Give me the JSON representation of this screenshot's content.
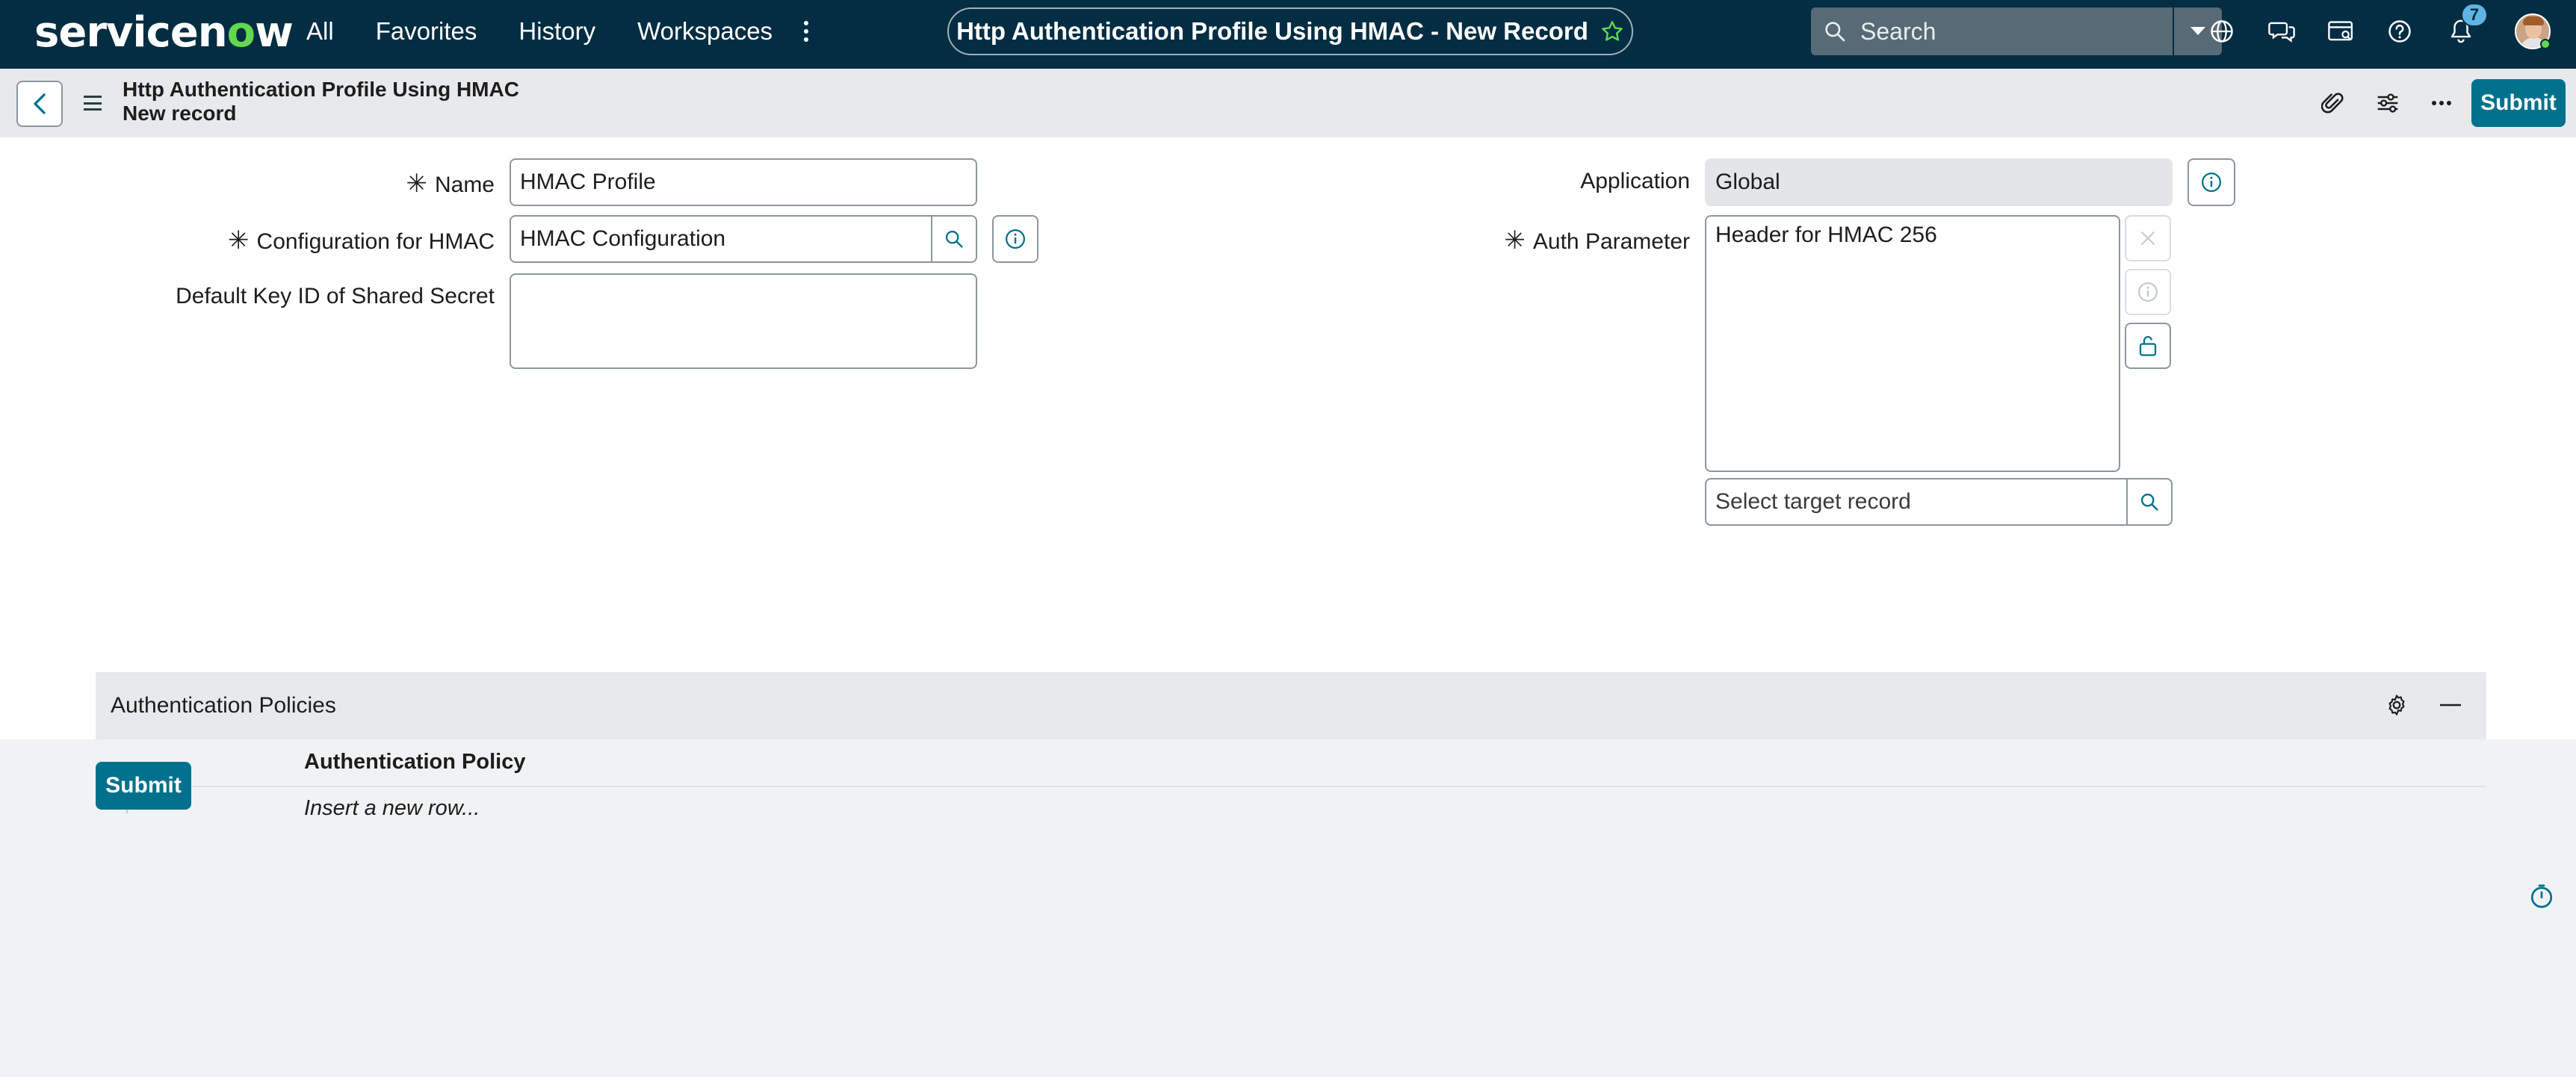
{
  "nav": {
    "logo_pre": "servicen",
    "logo_o": "o",
    "logo_post": "w",
    "links": [
      "All",
      "Favorites",
      "History",
      "Workspaces"
    ],
    "record_title": "Http Authentication Profile Using HMAC - New Record",
    "search_placeholder": "Search",
    "notification_count": "7"
  },
  "header": {
    "title": "Http Authentication Profile Using HMAC",
    "subtitle": "New record",
    "submit_label": "Submit"
  },
  "form": {
    "name_label": "Name",
    "name_value": "HMAC Profile",
    "config_label": "Configuration for HMAC",
    "config_value": "HMAC Configuration",
    "default_key_label": "Default Key ID of Shared Secret",
    "default_key_value": "",
    "application_label": "Application",
    "application_value": "Global",
    "auth_param_label": "Auth Parameter",
    "auth_param_value": "Header for HMAC 256",
    "target_record_placeholder": "Select target record",
    "required_marker": "✳"
  },
  "related_list": {
    "title": "Authentication Policies",
    "column": "Authentication Policy",
    "insert_row": "Insert a new row..."
  },
  "footer": {
    "submit_label": "Submit"
  },
  "colors": {
    "nav_bg": "#032d42",
    "accent": "#00718c",
    "brand_green": "#62d84e"
  }
}
